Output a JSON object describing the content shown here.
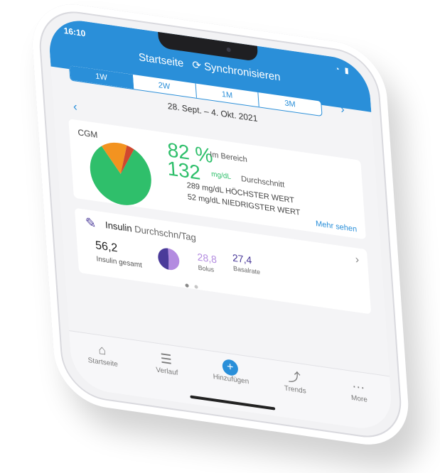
{
  "status": {
    "time": "16:10"
  },
  "header": {
    "title": "Startseite",
    "sync_label": "Synchronisieren"
  },
  "tabs": [
    {
      "label": "1W"
    },
    {
      "label": "2W"
    },
    {
      "label": "1M"
    },
    {
      "label": "3M"
    }
  ],
  "date_range": "28. Sept. – 4. Okt. 2021",
  "cgm": {
    "label": "CGM",
    "in_range_value": "82 %",
    "in_range_label": "Im Bereich",
    "average_value": "132",
    "average_unit": "mg/dL",
    "average_label": "Durchschnitt",
    "max_text": "289 mg/dL HÖCHSTER WERT",
    "min_text": "52 mg/dL NIEDRIGSTER WERT",
    "more_link": "Mehr sehen",
    "pie_slices": [
      {
        "name": "in_range",
        "value": 82,
        "color": "#2fbf6b"
      },
      {
        "name": "high",
        "value": 14,
        "color": "#f39320"
      },
      {
        "name": "low",
        "value": 4,
        "color": "#d0482f"
      }
    ]
  },
  "insulin": {
    "title": "Insulin",
    "subtitle": "Durchschn/Tag",
    "total_value": "56,2",
    "total_label": "Insulin gesamt",
    "bolus_value": "28,8",
    "bolus_label": "Bolus",
    "basal_value": "27,4",
    "basal_label": "Basalrate",
    "bolus_color": "#b38be0",
    "basal_color": "#4b3b9a"
  },
  "bottom_nav": [
    {
      "label": "Startseite",
      "icon": "home-icon"
    },
    {
      "label": "Verlauf",
      "icon": "list-icon"
    },
    {
      "label": "Hinzufügen",
      "icon": "plus-icon"
    },
    {
      "label": "Trends",
      "icon": "trend-icon"
    },
    {
      "label": "More",
      "icon": "more-icon"
    }
  ],
  "colors": {
    "accent": "#2a8fd9",
    "green": "#2fbf6b"
  }
}
